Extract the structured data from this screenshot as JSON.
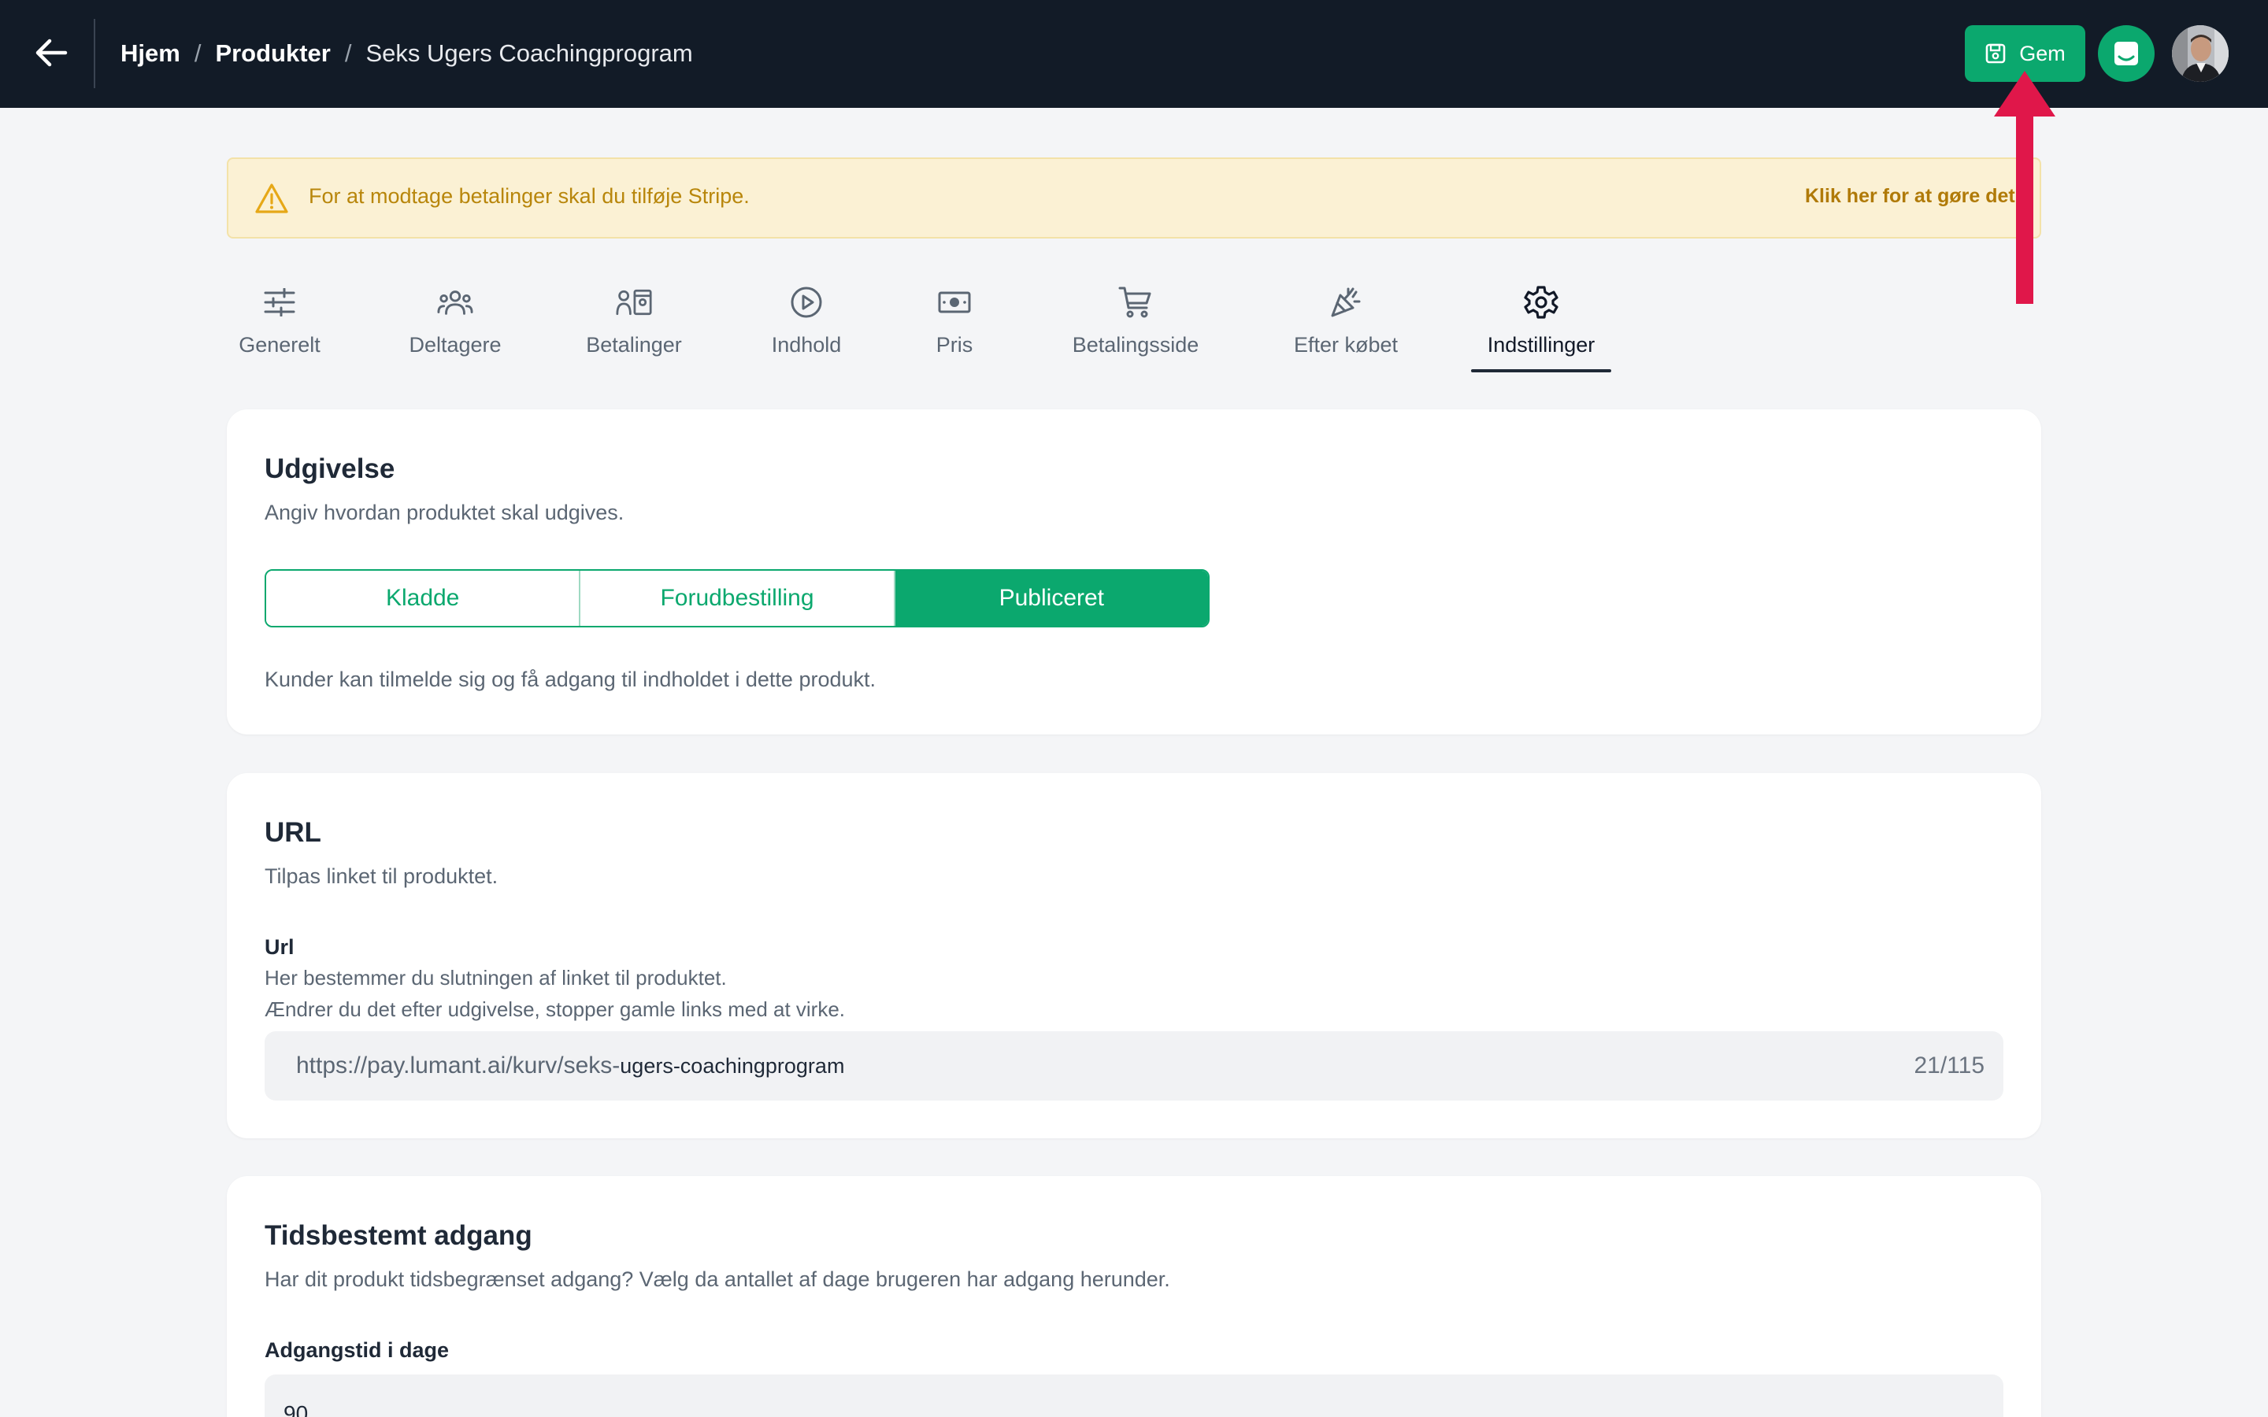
{
  "header": {
    "breadcrumb": {
      "home": "Hjem",
      "products": "Produkter",
      "current": "Seks Ugers Coachingprogram",
      "separator": "/"
    },
    "save_label": "Gem",
    "accent_color": "#0ba86e",
    "background_color": "#121b27"
  },
  "alert": {
    "text": "For at modtage betalinger skal du tilføje Stripe.",
    "link": "Klik her for at gøre det"
  },
  "tabs": [
    {
      "label": "Generelt",
      "icon": "sliders-icon"
    },
    {
      "label": "Deltagere",
      "icon": "users-icon"
    },
    {
      "label": "Betalinger",
      "icon": "user-payments-icon"
    },
    {
      "label": "Indhold",
      "icon": "play-circle-icon"
    },
    {
      "label": "Pris",
      "icon": "banknote-icon"
    },
    {
      "label": "Betalingsside",
      "icon": "cart-icon"
    },
    {
      "label": "Efter købet",
      "icon": "party-popper-icon"
    },
    {
      "label": "Indstillinger",
      "icon": "gear-icon",
      "active": true
    }
  ],
  "publishing": {
    "title": "Udgivelse",
    "description": "Angiv hvordan produktet skal udgives.",
    "options": [
      "Kladde",
      "Forudbestilling",
      "Publiceret"
    ],
    "selected": "Publiceret",
    "note": "Kunder kan tilmelde sig og få adgang til indholdet i dette produkt."
  },
  "url_section": {
    "title": "URL",
    "description": "Tilpas linket til produktet.",
    "field_label": "Url",
    "help_line1": "Her bestemmer du slutningen af linket til produktet.",
    "help_line2": "Ændrer du det efter udgivelse, stopper gamle links med at virke.",
    "prefix": "https://pay.lumant.ai/kurv/seks-",
    "value": "ugers-coachingprogram",
    "counter": "21/115"
  },
  "timed_access": {
    "title": "Tidsbestemt adgang",
    "description": "Har dit produkt tidsbegrænset adgang? Vælg da antallet af dage brugeren har adgang herunder.",
    "field_label": "Adgangstid i dage",
    "value": "90"
  },
  "annotation": {
    "arrow_color": "#e0174a"
  }
}
